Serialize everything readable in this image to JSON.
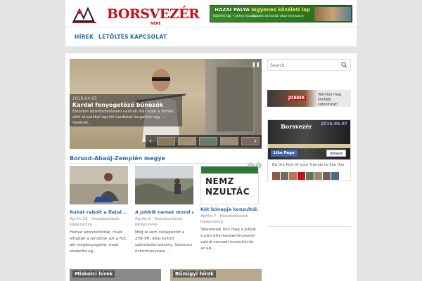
{
  "header": {
    "logo_name": "BORSVEZÉR",
    "logo_sub": "NÉPE",
    "banner": {
      "headline_left": "HAZAI PÁLYA",
      "headline_right": "Ingyenes közéleti lap",
      "sub_left": "közéleti lap • online kiadás",
      "sub_right": "a Jobbik aktivistái által terjesztve"
    }
  },
  "nav": {
    "items": [
      "HÍREK",
      "LETÖLTÉS",
      "KAPCSOLAT"
    ]
  },
  "slider": {
    "date": "2016-04-25",
    "title": "Kardal fenyegetőző bűnözők",
    "excerpt": "Előzetes letartóztatásban vannak már azok a férfiak, akik társaikkal együtt kardokat lengettek egy ... falaknál ..."
  },
  "section": {
    "title": "Borsod-Abaúj-Zemplén megye"
  },
  "cards": [
    {
      "title": "Ruhát rabolt a fiatal...",
      "meta_date": "Április 25",
      "meta_comments": "Hozzászólások",
      "meta_author": "kikapcsolva",
      "excerpt": "Hamar azonosították, majd elfogták a rendőrök azt a fiút, aki megfenyegette, majd elrabolta eg..."
    },
    {
      "title": "A Jobbik nemet mond az...",
      "meta_date": "Április 8",
      "meta_comments": "Hozzászólások",
      "meta_author": "kikapcsolva",
      "excerpt": "Még le sem csillapodott a ZHK Kft. által keltett számlázási botrány, Szerencs önkormányzata ..."
    },
    {
      "title": "Két hónapja konzultál...",
      "meta_date": "Április 7",
      "meta_comments": "Hozzászólások",
      "meta_author": "kikapcsolva",
      "excerpt": "Sikeresnek ítéli meg a Jobbik a párt által kezdeményezett valódi nemzeti konzultációt az els..."
    }
  ],
  "card3_image_text": "NEMZ NZULTÁC",
  "bottom": {
    "left_label": "Miskolci hírek",
    "right_label": "Bűnügyi hírek"
  },
  "sidebar": {
    "search_placeholder": "Search",
    "jobbik_name": "JOBBIK",
    "jobbik_text": "Tekintse meg korábbi videóinkat!",
    "fb": {
      "page_name": "Borsvezér",
      "date": "2016.05.07",
      "like": "Like Page",
      "share": "Share",
      "first_friend": "Be the first of your friends to like this"
    }
  },
  "colors": {
    "brand_red": "#c2121b",
    "link_blue": "#2b6aa8"
  }
}
